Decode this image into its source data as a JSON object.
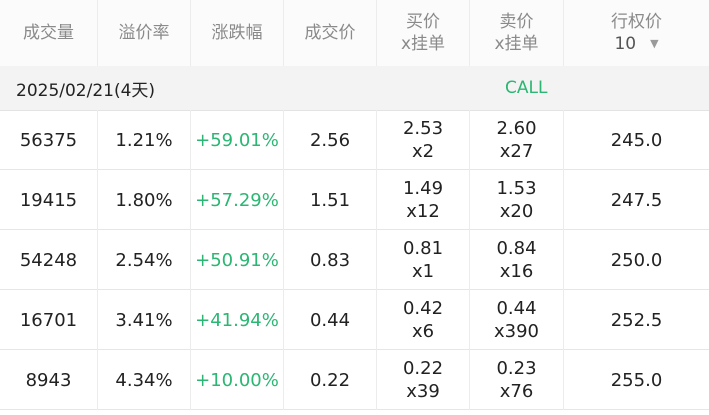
{
  "header": {
    "volume": "成交量",
    "premium": "溢价率",
    "change": "涨跌幅",
    "last": "成交价",
    "bid_line1": "买价",
    "bid_line2": "x挂单",
    "ask_line1": "卖价",
    "ask_line2": "x挂单",
    "strike_line1": "行权价",
    "strike_count": "10",
    "dropdown_icon": "caret-down-icon"
  },
  "section": {
    "expiry": "2025/02/21(4天)",
    "type": "CALL"
  },
  "colors": {
    "positive": "#2bb673",
    "header_text": "#8a8a8a"
  },
  "rows": [
    {
      "volume": "56375",
      "premium": "1.21%",
      "change": "+59.01%",
      "last": "2.56",
      "bid": "2.53",
      "bid_size": "x2",
      "ask": "2.60",
      "ask_size": "x27",
      "strike": "245.0"
    },
    {
      "volume": "19415",
      "premium": "1.80%",
      "change": "+57.29%",
      "last": "1.51",
      "bid": "1.49",
      "bid_size": "x12",
      "ask": "1.53",
      "ask_size": "x20",
      "strike": "247.5"
    },
    {
      "volume": "54248",
      "premium": "2.54%",
      "change": "+50.91%",
      "last": "0.83",
      "bid": "0.81",
      "bid_size": "x1",
      "ask": "0.84",
      "ask_size": "x16",
      "strike": "250.0"
    },
    {
      "volume": "16701",
      "premium": "3.41%",
      "change": "+41.94%",
      "last": "0.44",
      "bid": "0.42",
      "bid_size": "x6",
      "ask": "0.44",
      "ask_size": "x390",
      "strike": "252.5"
    },
    {
      "volume": "8943",
      "premium": "4.34%",
      "change": "+10.00%",
      "last": "0.22",
      "bid": "0.22",
      "bid_size": "x39",
      "ask": "0.23",
      "ask_size": "x76",
      "strike": "255.0"
    }
  ]
}
